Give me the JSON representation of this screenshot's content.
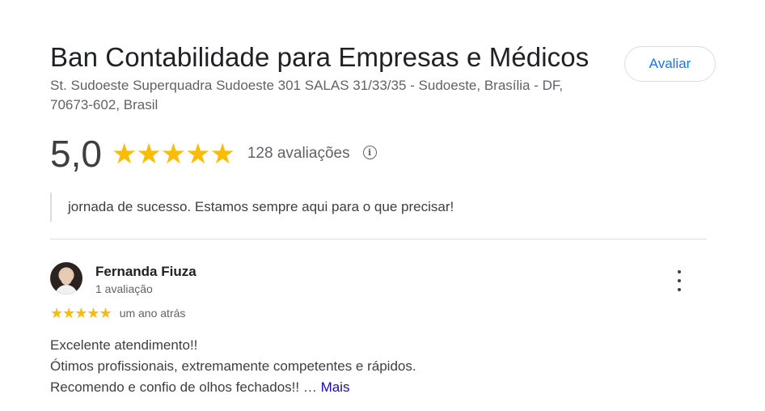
{
  "business": {
    "name": "Ban Contabilidade para Empresas e Médicos",
    "address": "St. Sudoeste Superquadra Sudoeste 301 SALAS 31/33/35 - Sudoeste, Brasília - DF, 70673-602, Brasil",
    "rate_button_label": "Avaliar"
  },
  "rating_summary": {
    "score": "5,0",
    "stars": 5,
    "stars_text": "★★★★★",
    "reviews_count": "128 avaliações",
    "info_icon": "info-icon"
  },
  "quote": {
    "text": "jornada de sucesso. Estamos sempre aqui para o que precisar!"
  },
  "review": {
    "author": "Fernanda Fiuza",
    "author_meta": "1 avaliação",
    "stars": 5,
    "stars_text": "★★★★★",
    "time": "um ano atrás",
    "lines": [
      "Excelente atendimento!!",
      "Ótimos profissionais, extremamente competentes e rápidos.",
      "Recomendo e confio de olhos fechados!! …"
    ],
    "more_label": "Mais",
    "menu_icon": "more-vert-icon"
  },
  "colors": {
    "star": "#fbbc04",
    "link_blue": "#1a73e8",
    "more_link": "#1a0dab"
  }
}
